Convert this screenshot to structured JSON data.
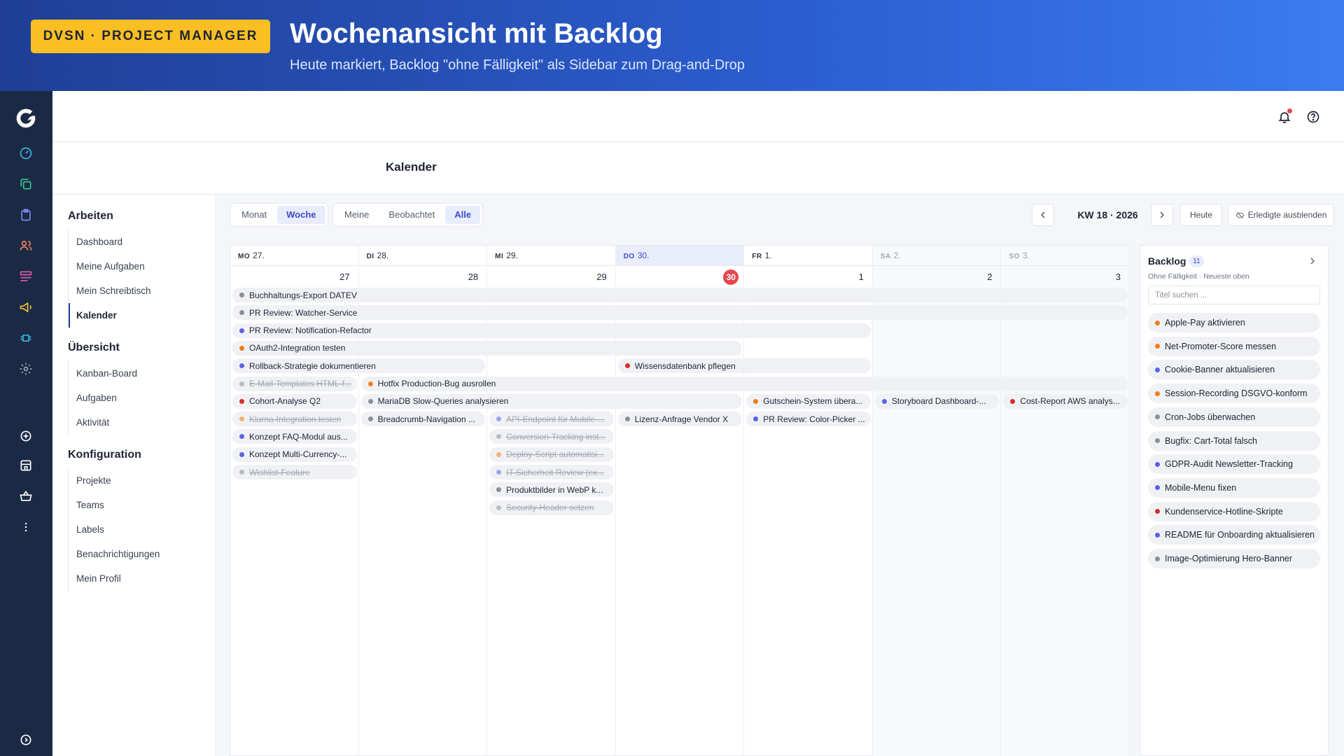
{
  "banner": {
    "badge": "DVSN · PROJECT MANAGER",
    "title": "Wochenansicht mit Backlog",
    "subtitle": "Heute markiert, Backlog \"ohne Fälligkeit\" als Sidebar zum Drag-and-Drop"
  },
  "colors": {
    "accent": "#3b4bc8",
    "today": "#e5484d",
    "badge": "#fbbf24",
    "dot_gray": "#8a8f99",
    "dot_blue": "#5b63e6",
    "dot_orange": "#f07d1a",
    "dot_red": "#d92d2d"
  },
  "rail": {
    "icons": [
      "logo-icon",
      "dashboard-icon",
      "copy-icon",
      "clipboard-icon",
      "users-icon",
      "list-icon",
      "megaphone-icon",
      "chip-icon",
      "settings-icon",
      "plus-circle-icon",
      "store-icon",
      "basket-icon",
      "more-icon",
      "expand-icon"
    ]
  },
  "page": {
    "title": "Kalender"
  },
  "nav": {
    "groups": [
      {
        "title": "Arbeiten",
        "items": [
          "Dashboard",
          "Meine Aufgaben",
          "Mein Schreibtisch",
          "Kalender"
        ]
      },
      {
        "title": "Übersicht",
        "items": [
          "Kanban-Board",
          "Aufgaben",
          "Aktivität"
        ]
      },
      {
        "title": "Konfiguration",
        "items": [
          "Projekte",
          "Teams",
          "Labels",
          "Benachrichtigungen",
          "Mein Profil"
        ]
      }
    ],
    "active": "Kalender"
  },
  "toolbar": {
    "view_modes": [
      "Monat",
      "Woche"
    ],
    "view_selected": "Woche",
    "filters": [
      "Meine",
      "Beobachtet",
      "Alle"
    ],
    "filter_selected": "Alle",
    "week_label": "KW 18 · 2026",
    "today_button": "Heute",
    "hide_done_button": "Erledigte ausblenden"
  },
  "calendar": {
    "days": [
      {
        "weekday": "MO",
        "date": "27.",
        "num": "27",
        "today": false,
        "weekend": false
      },
      {
        "weekday": "DI",
        "date": "28.",
        "num": "28",
        "today": false,
        "weekend": false
      },
      {
        "weekday": "MI",
        "date": "29.",
        "num": "29",
        "today": false,
        "weekend": false
      },
      {
        "weekday": "DO",
        "date": "30.",
        "num": "30",
        "today": true,
        "weekend": false
      },
      {
        "weekday": "FR",
        "date": "1.",
        "num": "1",
        "today": false,
        "weekend": false
      },
      {
        "weekday": "SA",
        "date": "2.",
        "num": "2",
        "today": false,
        "weekend": true
      },
      {
        "weekday": "SO",
        "date": "3.",
        "num": "3",
        "today": false,
        "weekend": true
      }
    ],
    "events": [
      {
        "title": "Buchhaltungs-Export DATEV",
        "color": "gray",
        "start": 0,
        "span": 7,
        "row": 0,
        "done": false
      },
      {
        "title": "PR Review: Watcher-Service",
        "color": "gray",
        "start": 0,
        "span": 7,
        "row": 1,
        "done": false
      },
      {
        "title": "PR Review: Notification-Refactor",
        "color": "blue",
        "start": 0,
        "span": 5,
        "row": 2,
        "done": false
      },
      {
        "title": "OAuth2-Integration testen",
        "color": "orange",
        "start": 0,
        "span": 4,
        "row": 3,
        "done": false
      },
      {
        "title": "Rollback-Strategie dokumentieren",
        "color": "blue",
        "start": 0,
        "span": 2,
        "row": 4,
        "done": false
      },
      {
        "title": "Wissensdatenbank pflegen",
        "color": "red",
        "start": 3,
        "span": 2,
        "row": 4,
        "done": false
      },
      {
        "title": "E-Mail-Templates HTML-f...",
        "color": "gray",
        "start": 0,
        "span": 1,
        "row": 5,
        "done": true
      },
      {
        "title": "Hotfix Production-Bug ausrollen",
        "color": "orange",
        "start": 1,
        "span": 6,
        "row": 5,
        "done": false
      },
      {
        "title": "Cohort-Analyse Q2",
        "color": "red",
        "start": 0,
        "span": 1,
        "row": 6,
        "done": false
      },
      {
        "title": "MariaDB Slow-Queries analysieren",
        "color": "gray",
        "start": 1,
        "span": 3,
        "row": 6,
        "done": false
      },
      {
        "title": "Gutschein-System übera...",
        "color": "orange",
        "start": 4,
        "span": 1,
        "row": 6,
        "done": false
      },
      {
        "title": "Storyboard Dashboard-...",
        "color": "blue",
        "start": 5,
        "span": 1,
        "row": 6,
        "done": false
      },
      {
        "title": "Cost-Report AWS analys...",
        "color": "red",
        "start": 6,
        "span": 1,
        "row": 6,
        "done": false
      },
      {
        "title": "Klarna-Integration testen",
        "color": "orange",
        "start": 0,
        "span": 1,
        "row": 7,
        "done": true
      },
      {
        "title": "Breadcrumb-Navigation ...",
        "color": "gray",
        "start": 1,
        "span": 1,
        "row": 7,
        "done": false
      },
      {
        "title": "API-Endpoint für Mobile-...",
        "color": "blue",
        "start": 2,
        "span": 1,
        "row": 7,
        "done": true
      },
      {
        "title": "Lizenz-Anfrage Vendor X",
        "color": "gray",
        "start": 3,
        "span": 1,
        "row": 7,
        "done": false
      },
      {
        "title": "PR Review: Color-Picker ...",
        "color": "blue",
        "start": 4,
        "span": 1,
        "row": 7,
        "done": false
      },
      {
        "title": "Konzept FAQ-Modul aus...",
        "color": "blue",
        "start": 0,
        "span": 1,
        "row": 8,
        "done": false
      },
      {
        "title": "Conversion-Tracking inst...",
        "color": "gray",
        "start": 2,
        "span": 1,
        "row": 8,
        "done": true
      },
      {
        "title": "Konzept Multi-Currency-...",
        "color": "blue",
        "start": 0,
        "span": 1,
        "row": 9,
        "done": false
      },
      {
        "title": "Deploy-Script automatisi...",
        "color": "orange",
        "start": 2,
        "span": 1,
        "row": 9,
        "done": true
      },
      {
        "title": "Wishlist-Feature",
        "color": "gray",
        "start": 0,
        "span": 1,
        "row": 10,
        "done": true
      },
      {
        "title": "IT-Sicherheit Review (ex...",
        "color": "blue",
        "start": 2,
        "span": 1,
        "row": 10,
        "done": true
      },
      {
        "title": "Produktbilder in WebP k...",
        "color": "gray",
        "start": 2,
        "span": 1,
        "row": 11,
        "done": false
      },
      {
        "title": "Security-Header setzen",
        "color": "gray",
        "start": 2,
        "span": 1,
        "row": 12,
        "done": true
      }
    ]
  },
  "backlog": {
    "title": "Backlog",
    "count": "11",
    "subtitle": "Ohne Fälligkeit · Neueste oben",
    "search_placeholder": "Titel suchen ...",
    "items": [
      {
        "title": "Apple-Pay aktivieren",
        "color": "orange"
      },
      {
        "title": "Net-Promoter-Score messen",
        "color": "orange"
      },
      {
        "title": "Cookie-Banner aktualisieren",
        "color": "blue"
      },
      {
        "title": "Session-Recording DSGVO-konform",
        "color": "orange"
      },
      {
        "title": "Cron-Jobs überwachen",
        "color": "gray"
      },
      {
        "title": "Bugfix: Cart-Total falsch",
        "color": "gray"
      },
      {
        "title": "GDPR-Audit Newsletter-Tracking",
        "color": "blue"
      },
      {
        "title": "Mobile-Menu fixen",
        "color": "blue"
      },
      {
        "title": "Kundenservice-Hotline-Skripte",
        "color": "red"
      },
      {
        "title": "README für Onboarding aktualisieren",
        "color": "blue"
      },
      {
        "title": "Image-Optimierung Hero-Banner",
        "color": "gray"
      }
    ]
  }
}
